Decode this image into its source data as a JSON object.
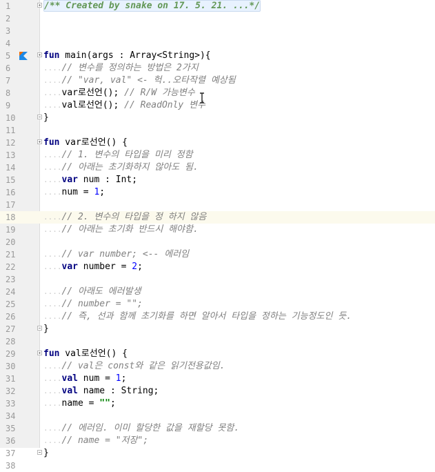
{
  "editor": {
    "lines": [
      {
        "n": "1",
        "fold": "open",
        "current": false,
        "segs": [
          [
            "doc",
            "/** Created by snake on 17. 5. 21. ...*/"
          ]
        ]
      },
      {
        "n": "2",
        "segs": []
      },
      {
        "n": "3",
        "segs": []
      },
      {
        "n": "4",
        "segs": []
      },
      {
        "n": "5",
        "fold": "open",
        "run": true,
        "segs": [
          [
            "kw",
            "fun"
          ],
          [
            "txt",
            " main(args : Array<String>){"
          ]
        ]
      },
      {
        "n": "6",
        "segs": [
          [
            "dots",
            "...."
          ],
          [
            "cm",
            "// 변수를 정의하는 방법은 2가지"
          ]
        ]
      },
      {
        "n": "7",
        "segs": [
          [
            "dots",
            "...."
          ],
          [
            "cm",
            "// \"var, val\" <- 헉..오타작렬 예상됨"
          ]
        ]
      },
      {
        "n": "8",
        "segs": [
          [
            "dots",
            "...."
          ],
          [
            "txt",
            "var로선언();"
          ],
          [
            "cm",
            " // R/W 가능변수"
          ]
        ]
      },
      {
        "n": "9",
        "segs": [
          [
            "dots",
            "...."
          ],
          [
            "txt",
            "val로선언();"
          ],
          [
            "cm",
            " // ReadOnly 변수"
          ]
        ]
      },
      {
        "n": "10",
        "fold": "close",
        "segs": [
          [
            "txt",
            "}"
          ]
        ]
      },
      {
        "n": "11",
        "segs": []
      },
      {
        "n": "12",
        "fold": "open",
        "segs": [
          [
            "kw",
            "fun"
          ],
          [
            "txt",
            " var로선언() {"
          ]
        ]
      },
      {
        "n": "13",
        "segs": [
          [
            "dots",
            "...."
          ],
          [
            "cm",
            "// 1. 변수의 타입을 미리 정함"
          ]
        ]
      },
      {
        "n": "14",
        "segs": [
          [
            "dots",
            "...."
          ],
          [
            "cm",
            "// 아래는 초기화하지 않아도 됨."
          ]
        ]
      },
      {
        "n": "15",
        "segs": [
          [
            "dots",
            "...."
          ],
          [
            "kw",
            "var"
          ],
          [
            "txt",
            " num : Int;"
          ]
        ]
      },
      {
        "n": "16",
        "segs": [
          [
            "dots",
            "...."
          ],
          [
            "txt",
            "num = "
          ],
          [
            "num",
            "1"
          ],
          [
            "txt",
            ";"
          ]
        ]
      },
      {
        "n": "17",
        "segs": []
      },
      {
        "n": "18",
        "current": true,
        "segs": [
          [
            "dots",
            "...."
          ],
          [
            "cm",
            "// 2. 변수의 타입을 정 하지 않음"
          ]
        ]
      },
      {
        "n": "19",
        "segs": [
          [
            "dots",
            "...."
          ],
          [
            "cm",
            "// 아래는 초기화 반드시 해야함."
          ]
        ]
      },
      {
        "n": "20",
        "segs": []
      },
      {
        "n": "21",
        "segs": [
          [
            "dots",
            "...."
          ],
          [
            "cm",
            "// var number; <-- 에러임"
          ]
        ]
      },
      {
        "n": "22",
        "segs": [
          [
            "dots",
            "...."
          ],
          [
            "kw",
            "var"
          ],
          [
            "txt",
            " number = "
          ],
          [
            "num",
            "2"
          ],
          [
            "txt",
            ";"
          ]
        ]
      },
      {
        "n": "23",
        "segs": []
      },
      {
        "n": "24",
        "segs": [
          [
            "dots",
            "...."
          ],
          [
            "cm",
            "// 아래도 에러발생"
          ]
        ]
      },
      {
        "n": "25",
        "segs": [
          [
            "dots",
            "...."
          ],
          [
            "cm",
            "// number = \"\";"
          ]
        ]
      },
      {
        "n": "26",
        "segs": [
          [
            "dots",
            "...."
          ],
          [
            "cm",
            "// 즉, 선과 함께 초기화를 하면 알아서 타입을 정하는 기능정도인 듯."
          ]
        ]
      },
      {
        "n": "27",
        "fold": "close",
        "segs": [
          [
            "txt",
            "}"
          ]
        ]
      },
      {
        "n": "28",
        "segs": []
      },
      {
        "n": "29",
        "fold": "open",
        "segs": [
          [
            "kw",
            "fun"
          ],
          [
            "txt",
            " val로선언() {"
          ]
        ]
      },
      {
        "n": "30",
        "segs": [
          [
            "dots",
            "...."
          ],
          [
            "cm",
            "// val은 const와 같은 읽기전용값임."
          ]
        ]
      },
      {
        "n": "31",
        "segs": [
          [
            "dots",
            "...."
          ],
          [
            "kw",
            "val"
          ],
          [
            "txt",
            " num = "
          ],
          [
            "num",
            "1"
          ],
          [
            "txt",
            ";"
          ]
        ]
      },
      {
        "n": "32",
        "segs": [
          [
            "dots",
            "...."
          ],
          [
            "kw",
            "val"
          ],
          [
            "txt",
            " name : String;"
          ]
        ]
      },
      {
        "n": "33",
        "segs": [
          [
            "dots",
            "...."
          ],
          [
            "txt",
            "name = "
          ],
          [
            "str",
            "\"\""
          ],
          [
            "txt",
            ";"
          ]
        ]
      },
      {
        "n": "34",
        "segs": []
      },
      {
        "n": "35",
        "segs": [
          [
            "dots",
            "...."
          ],
          [
            "cm",
            "// 에러임. 이미 할당한 값을 재할당 못함."
          ]
        ]
      },
      {
        "n": "36",
        "segs": [
          [
            "dots",
            "...."
          ],
          [
            "cm",
            "// name = \"저장\";"
          ]
        ]
      },
      {
        "n": "37",
        "fold": "close",
        "segs": [
          [
            "txt",
            "}"
          ]
        ]
      },
      {
        "n": "38",
        "segs": []
      }
    ]
  },
  "colors": {
    "keyword": "#000080",
    "comment": "#808080",
    "doc_comment": "#629755",
    "number": "#0000ff",
    "string": "#008000",
    "current_line": "#fcfaed",
    "gutter": "#f0f0f0"
  },
  "icons": {
    "run": "kotlin-run-icon",
    "mouse": "text-cursor-icon"
  }
}
